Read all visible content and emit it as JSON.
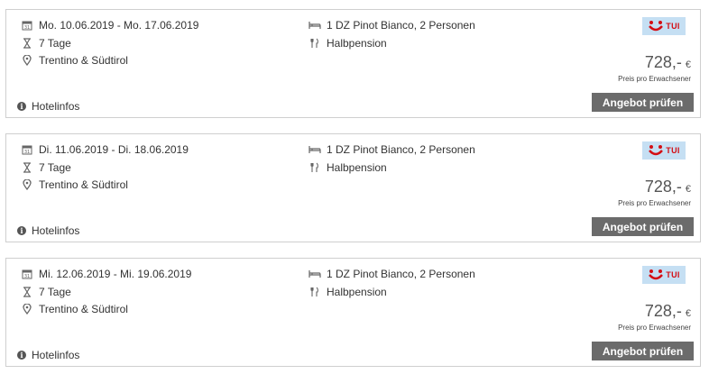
{
  "offers": [
    {
      "dates": "Mo. 10.06.2019 - Mo. 17.06.2019",
      "duration": "7 Tage",
      "region": "Trentino & Südtirol",
      "room": "1 DZ Pinot Bianco, 2 Personen",
      "board": "Halbpension",
      "price": "728,-",
      "currency": "€",
      "price_note": "Preis pro Erwachsener",
      "button": "Angebot prüfen",
      "hotelinfo": "Hotelinfos",
      "operator": "TUI"
    },
    {
      "dates": "Di. 11.06.2019 - Di. 18.06.2019",
      "duration": "7 Tage",
      "region": "Trentino & Südtirol",
      "room": "1 DZ Pinot Bianco, 2 Personen",
      "board": "Halbpension",
      "price": "728,-",
      "currency": "€",
      "price_note": "Preis pro Erwachsener",
      "button": "Angebot prüfen",
      "hotelinfo": "Hotelinfos",
      "operator": "TUI"
    },
    {
      "dates": "Mi. 12.06.2019 - Mi. 19.06.2019",
      "duration": "7 Tage",
      "region": "Trentino & Südtirol",
      "room": "1 DZ Pinot Bianco, 2 Personen",
      "board": "Halbpension",
      "price": "728,-",
      "currency": "€",
      "price_note": "Preis pro Erwachsener",
      "button": "Angebot prüfen",
      "hotelinfo": "Hotelinfos",
      "operator": "TUI"
    }
  ],
  "icons": {
    "calendar": "calendar-icon",
    "duration": "hourglass-icon",
    "location": "map-pin-icon",
    "room": "bed-icon",
    "board": "cutlery-icon",
    "info": "info-icon",
    "logo": "tui-logo"
  },
  "colors": {
    "button_bg": "#6b6b6b",
    "logo_bg": "#c5dff3",
    "logo_red": "#d40e14",
    "border": "#cfcfcf"
  }
}
